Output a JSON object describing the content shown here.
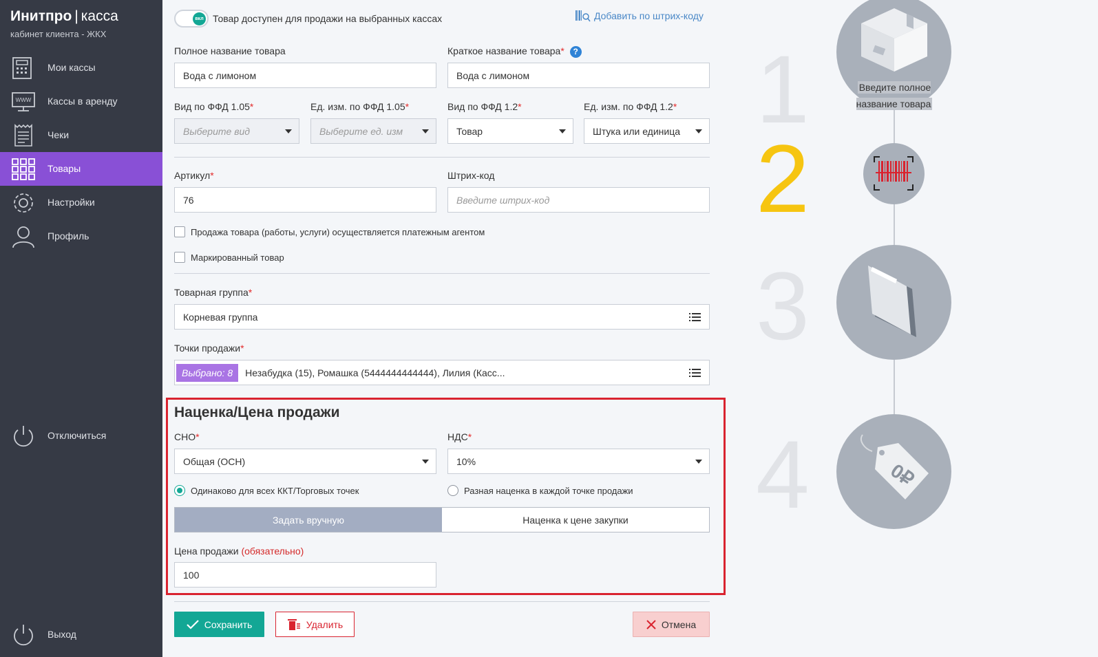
{
  "sidebar": {
    "brand": "Инитпро",
    "brand_sep": "|",
    "brand_product": "касса",
    "subtitle": "кабинет клиента - ЖКХ",
    "items": [
      {
        "label": "Мои кассы",
        "icon": "cash-register-icon"
      },
      {
        "label": "Кассы в аренду",
        "icon": "www-monitor-icon"
      },
      {
        "label": "Чеки",
        "icon": "receipt-icon"
      },
      {
        "label": "Товары",
        "icon": "grid-icon",
        "active": true
      },
      {
        "label": "Настройки",
        "icon": "gear-icon"
      },
      {
        "label": "Профиль",
        "icon": "user-icon"
      }
    ],
    "disconnect": "Отключиться",
    "logout": "Выход"
  },
  "form": {
    "toggle_state": "вкл",
    "toggle_label": "Товар доступен для продажи на выбранных кассах",
    "barcode_link": "Добавить по штрих-коду",
    "full_name_label": "Полное название товара",
    "full_name_value": "Вода с лимоном",
    "short_name_label": "Краткое название товара",
    "short_name_value": "Вода с лимоном",
    "help_glyph": "?",
    "req": "*",
    "type_105_label": "Вид по ФФД 1.05",
    "type_105_placeholder": "Выберите вид",
    "unit_105_label": "Ед. изм. по ФФД 1.05",
    "unit_105_placeholder": "Выберите ед. изм",
    "type_12_label": "Вид по ФФД 1.2",
    "type_12_value": "Товар",
    "unit_12_label": "Ед. изм. по ФФД 1.2",
    "unit_12_value": "Штука или единица",
    "article_label": "Артикул",
    "article_value": "76",
    "barcode_label": "Штрих-код",
    "barcode_placeholder": "Введите штрих-код",
    "agent_checkbox": "Продажа товара (работы, услуги) осуществляется платежным агентом",
    "marked_checkbox": "Маркированный товар",
    "group_label": "Товарная группа",
    "group_value": "Корневая группа",
    "points_label": "Точки продажи",
    "points_chip": "Выбрано: 8",
    "points_value": "Незабудка (15), Ромашка (5444444444444), Лилия (Касс..."
  },
  "pricing": {
    "title": "Наценка/Цена продажи",
    "sno_label": "СНО",
    "sno_value": "Общая (ОСН)",
    "vat_label": "НДС",
    "vat_value": "10%",
    "radio_same": "Одинаково для всех ККТ/Торговых точек",
    "radio_diff": "Разная наценка в каждой точке продажи",
    "seg_manual": "Задать вручную",
    "seg_markup": "Наценка к цене закупки",
    "price_label": "Цена продажи",
    "price_required": "(обязательно)",
    "price_value": "100"
  },
  "actions": {
    "save": "Сохранить",
    "delete": "Удалить",
    "cancel": "Отмена"
  },
  "steps": {
    "current": 2,
    "items": [
      {
        "num": "1",
        "icon": "box-icon",
        "hint": "Введите полное название товара"
      },
      {
        "num": "2",
        "icon": "barcode-icon"
      },
      {
        "num": "3",
        "icon": "folder-icon"
      },
      {
        "num": "4",
        "icon": "price-tag-icon",
        "tag_text": "0₽"
      }
    ],
    "active_color": "#f6c511"
  },
  "colors": {
    "accent_purple": "#8950d6",
    "teal": "#13a795",
    "danger": "#d9232f"
  }
}
